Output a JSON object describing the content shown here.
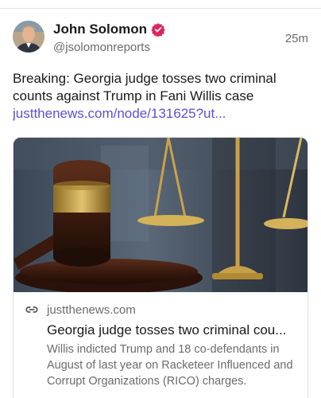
{
  "post": {
    "author_name": "John Solomon",
    "author_handle": "@jsolomonreports",
    "timestamp": "25m",
    "verified": true,
    "text": "Breaking: Georgia judge tosses two criminal counts against Trump in Fani Willis case",
    "link": "justthenews.com/node/131625?ut..."
  },
  "link_card": {
    "domain": "justthenews.com",
    "title": "Georgia judge tosses two criminal cou...",
    "description": "Willis indicted Trump and 18 co-defendants in August of last year on Racketeer Influenced and Corrupt Organizations (RICO) charges."
  },
  "icons": {
    "verified": "verified-badge-icon",
    "link": "link-icon"
  },
  "colors": {
    "link": "#5b4fd6",
    "verified_badge": "#e0245e",
    "secondary_text": "#6b6b6b"
  }
}
